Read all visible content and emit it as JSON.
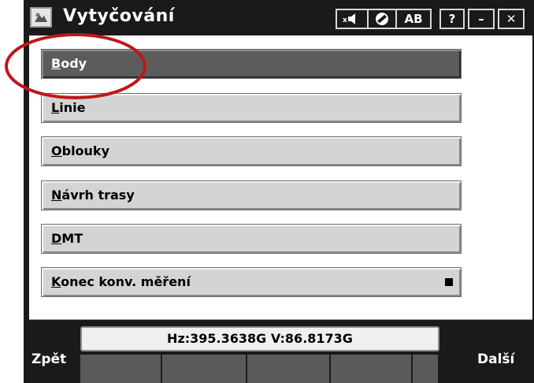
{
  "window": {
    "title": "Vytyčování",
    "icons": [
      "app-icon",
      "sound-mute-icon",
      "no-entry-icon"
    ],
    "ab_label": "AB",
    "help_label": "?",
    "minimize_label": "–",
    "close_label": "✕"
  },
  "menu": {
    "items": [
      {
        "label_first": "B",
        "label_rest": "ody",
        "selected": true
      },
      {
        "label_first": "L",
        "label_rest": "inie",
        "selected": false
      },
      {
        "label_first": "O",
        "label_rest": "blouky",
        "selected": false
      },
      {
        "label_first": "N",
        "label_rest": "ávrh trasy",
        "selected": false
      },
      {
        "label_first": "D",
        "label_rest": "MT",
        "selected": false
      },
      {
        "label_first": "K",
        "label_rest": "onec konv. měření",
        "selected": false
      }
    ]
  },
  "footer": {
    "back_label": "Zpět",
    "next_label": "Další",
    "status_text": "Hz:395.3638G  V:86.8173G"
  },
  "colors": {
    "frame": "#1a1a1a",
    "selected_button": "#5c5c5c",
    "button": "#d4d4d4",
    "annotation_circle": "#c0161b"
  }
}
